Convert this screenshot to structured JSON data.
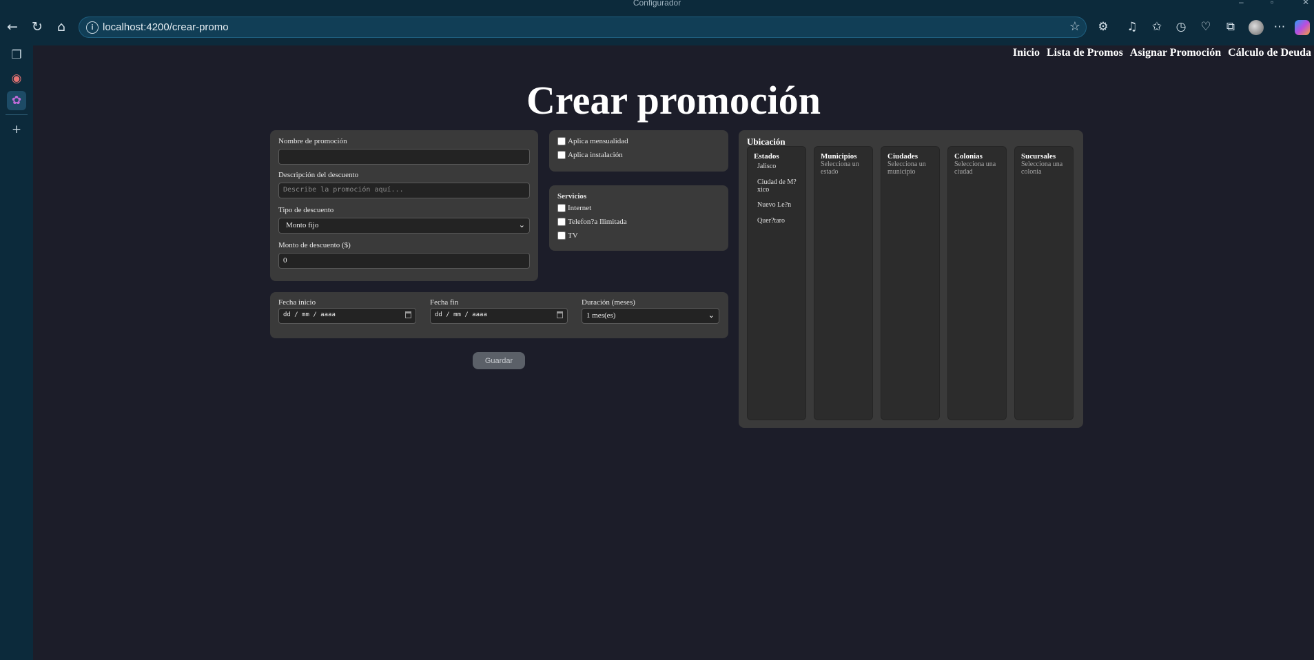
{
  "browser": {
    "window_title": "Configurador",
    "url": "localhost:4200/crear-promo"
  },
  "nav": [
    "Inicio",
    "Lista de Promos",
    "Asignar Promoción",
    "Cálculo de Deuda"
  ],
  "page_title": "Crear promoción",
  "form": {
    "nombre_label": "Nombre de promoción",
    "nombre_value": "",
    "descripcion_label": "Descripción del descuento",
    "descripcion_placeholder": "Describe la promoción aquí...",
    "tipo_label": "Tipo de descuento",
    "tipo_value": "Monto fijo",
    "monto_label": "Monto de descuento ($)",
    "monto_value": "0"
  },
  "aplica": {
    "mensualidad": "Aplica mensualidad",
    "instalacion": "Aplica instalación"
  },
  "servicios": {
    "title": "Servicios",
    "items": [
      "Internet",
      "Telefon?a Ilimitada",
      "TV"
    ]
  },
  "fechas": {
    "inicio_label": "Fecha inicio",
    "inicio_value": "dd / mm / aaaa",
    "fin_label": "Fecha fin",
    "fin_value": "dd / mm / aaaa",
    "duracion_label": "Duración (meses)",
    "duracion_value": "1 mes(es)"
  },
  "save_label": "Guardar",
  "ubicacion": {
    "title": "Ubicación",
    "columns": [
      {
        "title": "Estados",
        "items": [
          "Jalisco",
          "Ciudad de M?xico",
          "Nuevo Le?n",
          "Quer?taro"
        ]
      },
      {
        "title": "Municipios",
        "hint": "Selecciona un estado"
      },
      {
        "title": "Ciudades",
        "hint": "Selecciona un municipio"
      },
      {
        "title": "Colonias",
        "hint": "Selecciona una ciudad"
      },
      {
        "title": "Sucursales",
        "hint": "Selecciona una colonia"
      }
    ]
  }
}
